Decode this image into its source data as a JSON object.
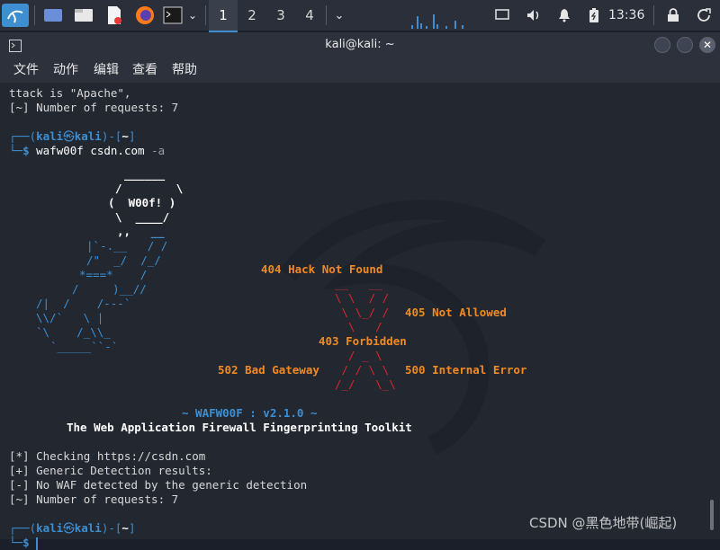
{
  "taskbar": {
    "workspaces": [
      "1",
      "2",
      "3",
      "4"
    ],
    "clock": "13:36"
  },
  "window": {
    "title": "kali@kali: ~"
  },
  "menu": [
    "文件",
    "动作",
    "编辑",
    "查看",
    "帮助"
  ],
  "terminal": {
    "line1": "ttack is \"Apache\",",
    "line2": "[~] Number of requests: 7",
    "prompt_user": "kali",
    "prompt_host": "kali",
    "prompt_dir": "~",
    "command": "wafw00f csdn.com",
    "command_arg": "-a",
    "art_woof": "W00f!",
    "label_404": "404 Hack Not Found",
    "label_405": "405 Not Allowed",
    "label_403": "403 Forbidden",
    "label_502": "502 Bad Gateway",
    "label_500": "500 Internal Error",
    "version": "~ WAFW00F : v2.1.0 ~",
    "tagline": "The Web Application Firewall Fingerprinting Toolkit",
    "out1": "[*] Checking https://csdn.com",
    "out2": "[+] Generic Detection results:",
    "out3": "[-] No WAF detected by the generic detection",
    "out4": "[~] Number of requests: 7"
  },
  "watermark": "CSDN @黑色地带(崛起)",
  "colors": {
    "accent": "#3d8fd1",
    "orange": "#f08a24",
    "red": "#d8262d",
    "background": "#232730"
  }
}
